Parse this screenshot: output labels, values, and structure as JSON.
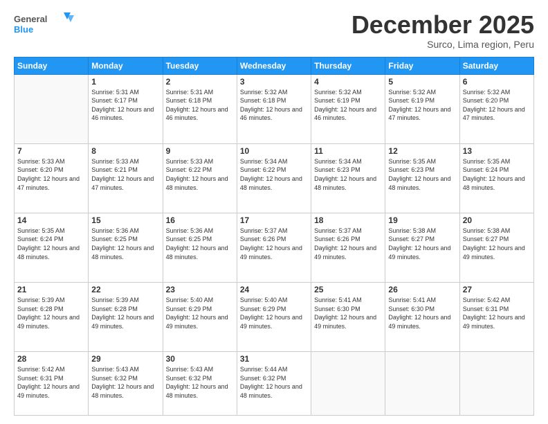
{
  "header": {
    "logo": {
      "general": "General",
      "blue": "Blue"
    },
    "title": "December 2025",
    "location": "Surco, Lima region, Peru"
  },
  "weekdays": [
    "Sunday",
    "Monday",
    "Tuesday",
    "Wednesday",
    "Thursday",
    "Friday",
    "Saturday"
  ],
  "weeks": [
    [
      {
        "day": "",
        "info": ""
      },
      {
        "day": "1",
        "info": "Sunrise: 5:31 AM\nSunset: 6:17 PM\nDaylight: 12 hours and 46 minutes."
      },
      {
        "day": "2",
        "info": "Sunrise: 5:31 AM\nSunset: 6:18 PM\nDaylight: 12 hours and 46 minutes."
      },
      {
        "day": "3",
        "info": "Sunrise: 5:32 AM\nSunset: 6:18 PM\nDaylight: 12 hours and 46 minutes."
      },
      {
        "day": "4",
        "info": "Sunrise: 5:32 AM\nSunset: 6:19 PM\nDaylight: 12 hours and 46 minutes."
      },
      {
        "day": "5",
        "info": "Sunrise: 5:32 AM\nSunset: 6:19 PM\nDaylight: 12 hours and 47 minutes."
      },
      {
        "day": "6",
        "info": "Sunrise: 5:32 AM\nSunset: 6:20 PM\nDaylight: 12 hours and 47 minutes."
      }
    ],
    [
      {
        "day": "7",
        "info": "Sunrise: 5:33 AM\nSunset: 6:20 PM\nDaylight: 12 hours and 47 minutes."
      },
      {
        "day": "8",
        "info": "Sunrise: 5:33 AM\nSunset: 6:21 PM\nDaylight: 12 hours and 47 minutes."
      },
      {
        "day": "9",
        "info": "Sunrise: 5:33 AM\nSunset: 6:22 PM\nDaylight: 12 hours and 48 minutes."
      },
      {
        "day": "10",
        "info": "Sunrise: 5:34 AM\nSunset: 6:22 PM\nDaylight: 12 hours and 48 minutes."
      },
      {
        "day": "11",
        "info": "Sunrise: 5:34 AM\nSunset: 6:23 PM\nDaylight: 12 hours and 48 minutes."
      },
      {
        "day": "12",
        "info": "Sunrise: 5:35 AM\nSunset: 6:23 PM\nDaylight: 12 hours and 48 minutes."
      },
      {
        "day": "13",
        "info": "Sunrise: 5:35 AM\nSunset: 6:24 PM\nDaylight: 12 hours and 48 minutes."
      }
    ],
    [
      {
        "day": "14",
        "info": "Sunrise: 5:35 AM\nSunset: 6:24 PM\nDaylight: 12 hours and 48 minutes."
      },
      {
        "day": "15",
        "info": "Sunrise: 5:36 AM\nSunset: 6:25 PM\nDaylight: 12 hours and 48 minutes."
      },
      {
        "day": "16",
        "info": "Sunrise: 5:36 AM\nSunset: 6:25 PM\nDaylight: 12 hours and 48 minutes."
      },
      {
        "day": "17",
        "info": "Sunrise: 5:37 AM\nSunset: 6:26 PM\nDaylight: 12 hours and 49 minutes."
      },
      {
        "day": "18",
        "info": "Sunrise: 5:37 AM\nSunset: 6:26 PM\nDaylight: 12 hours and 49 minutes."
      },
      {
        "day": "19",
        "info": "Sunrise: 5:38 AM\nSunset: 6:27 PM\nDaylight: 12 hours and 49 minutes."
      },
      {
        "day": "20",
        "info": "Sunrise: 5:38 AM\nSunset: 6:27 PM\nDaylight: 12 hours and 49 minutes."
      }
    ],
    [
      {
        "day": "21",
        "info": "Sunrise: 5:39 AM\nSunset: 6:28 PM\nDaylight: 12 hours and 49 minutes."
      },
      {
        "day": "22",
        "info": "Sunrise: 5:39 AM\nSunset: 6:28 PM\nDaylight: 12 hours and 49 minutes."
      },
      {
        "day": "23",
        "info": "Sunrise: 5:40 AM\nSunset: 6:29 PM\nDaylight: 12 hours and 49 minutes."
      },
      {
        "day": "24",
        "info": "Sunrise: 5:40 AM\nSunset: 6:29 PM\nDaylight: 12 hours and 49 minutes."
      },
      {
        "day": "25",
        "info": "Sunrise: 5:41 AM\nSunset: 6:30 PM\nDaylight: 12 hours and 49 minutes."
      },
      {
        "day": "26",
        "info": "Sunrise: 5:41 AM\nSunset: 6:30 PM\nDaylight: 12 hours and 49 minutes."
      },
      {
        "day": "27",
        "info": "Sunrise: 5:42 AM\nSunset: 6:31 PM\nDaylight: 12 hours and 49 minutes."
      }
    ],
    [
      {
        "day": "28",
        "info": "Sunrise: 5:42 AM\nSunset: 6:31 PM\nDaylight: 12 hours and 49 minutes."
      },
      {
        "day": "29",
        "info": "Sunrise: 5:43 AM\nSunset: 6:32 PM\nDaylight: 12 hours and 48 minutes."
      },
      {
        "day": "30",
        "info": "Sunrise: 5:43 AM\nSunset: 6:32 PM\nDaylight: 12 hours and 48 minutes."
      },
      {
        "day": "31",
        "info": "Sunrise: 5:44 AM\nSunset: 6:32 PM\nDaylight: 12 hours and 48 minutes."
      },
      {
        "day": "",
        "info": ""
      },
      {
        "day": "",
        "info": ""
      },
      {
        "day": "",
        "info": ""
      }
    ]
  ]
}
